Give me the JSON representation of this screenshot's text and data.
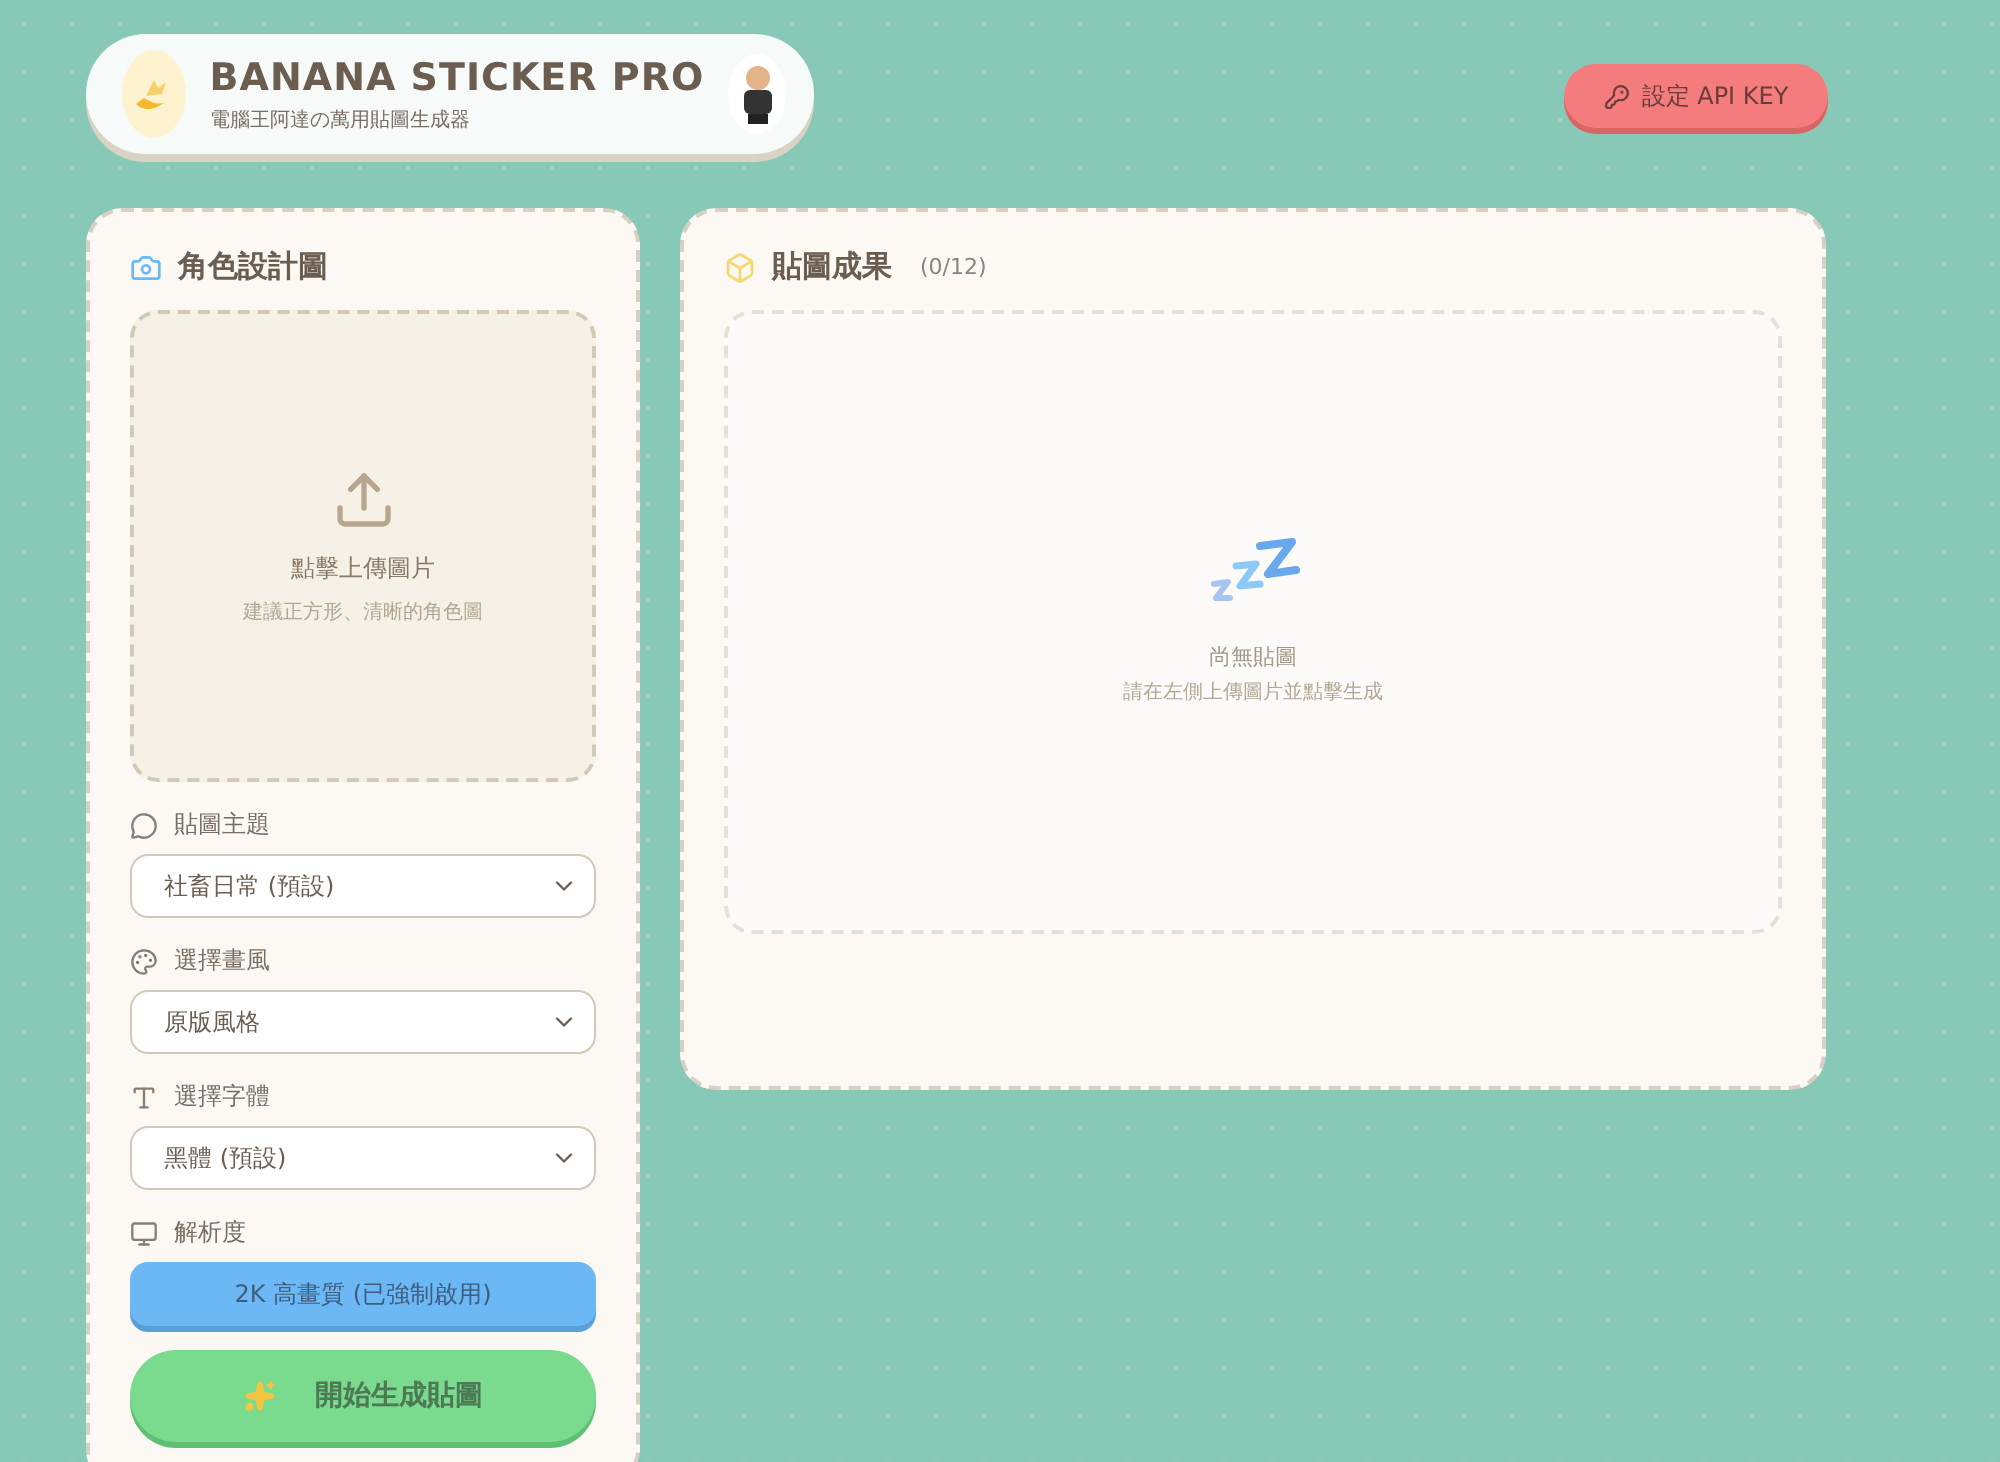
{
  "header": {
    "title": "BANANA STICKER PRO",
    "subtitle": "電腦王阿達の萬用貼圖生成器"
  },
  "api_button": {
    "label": "設定 API KEY"
  },
  "character_panel": {
    "title": "角色設計圖",
    "upload": {
      "label": "點擊上傳圖片",
      "hint": "建議正方形、清晰的角色圖"
    },
    "fields": [
      {
        "kind": "select",
        "label": "貼圖主題",
        "value": "社畜日常 (預設)"
      },
      {
        "kind": "select",
        "label": "選擇畫風",
        "value": "原版風格"
      },
      {
        "kind": "select",
        "label": "選擇字體",
        "value": "黑體 (預設)"
      },
      {
        "kind": "button",
        "label": "解析度",
        "value": "2K 高畫質 (已強制啟用)"
      }
    ],
    "generate_button": {
      "label": "開始生成貼圖"
    }
  },
  "result_panel": {
    "title": "貼圖成果",
    "count": "(0/12)",
    "empty_title": "尚無貼圖",
    "empty_hint": "請在左側上傳圖片並點擊生成"
  }
}
